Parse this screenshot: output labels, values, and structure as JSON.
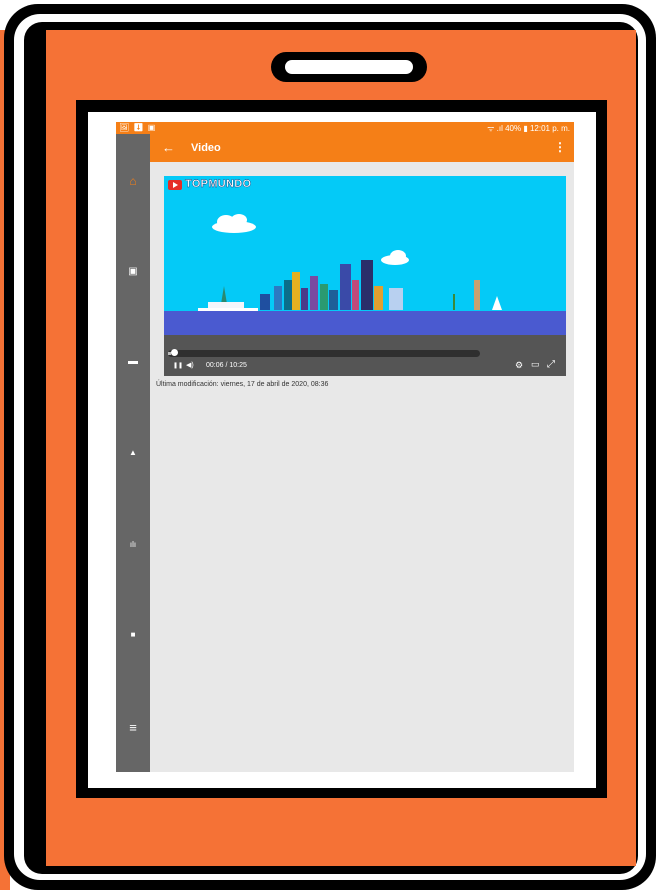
{
  "status_bar": {
    "left_icons": "🖼 ⬇ ▣",
    "right_text": "ᯤ .ıl 40% ▮ 12:01 p. m."
  },
  "app_bar": {
    "back_icon": "←",
    "title": "Video",
    "menu_icon": "⋮"
  },
  "nav": {
    "items": [
      {
        "icon": "home-icon",
        "glyph": "⌂"
      },
      {
        "icon": "calendar-icon",
        "glyph": "▣"
      },
      {
        "icon": "chat-icon",
        "glyph": "▬"
      },
      {
        "icon": "bell-icon",
        "glyph": "▲"
      },
      {
        "icon": "stats-icon",
        "glyph": "ılı"
      },
      {
        "icon": "folder-icon",
        "glyph": "■"
      },
      {
        "icon": "menu-icon",
        "glyph": "≡"
      }
    ]
  },
  "video": {
    "channel": "TOPMUNDO",
    "time": "00:06 / 10:25",
    "progress": 0.01,
    "play_glyph": "❚❚",
    "volume_glyph": "◀)",
    "settings_glyph": "⚙",
    "captions_glyph": "▭",
    "fullscreen_glyph": "⤢"
  },
  "footer": {
    "modified": "Última modificación: viernes, 17 de abril de 2020, 08:36"
  },
  "colors": {
    "frame_orange": "#f57236",
    "bar_orange": "#f57f17",
    "nav_gray": "#666666",
    "sky": "#04caf7"
  }
}
